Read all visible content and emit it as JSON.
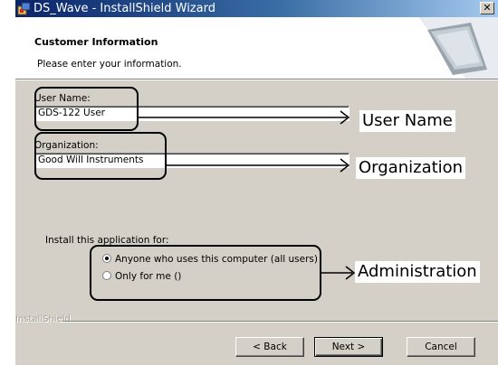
{
  "window": {
    "title": "DS_Wave - InstallShield Wizard"
  },
  "header": {
    "title": "Customer Information",
    "subtitle": "Please enter your information."
  },
  "form": {
    "user_name_label": "User Name:",
    "user_name_value": "GDS-122 User",
    "organization_label": "Organization:",
    "organization_value": "Good Will Instruments",
    "install_for_label": "Install this application for:",
    "radio_all_users": "Anyone who uses this computer (all users)",
    "radio_only_me": "Only for me ()"
  },
  "footer": {
    "brand": "InstallShield",
    "back_button": "< Back",
    "next_button": "Next >",
    "cancel_button": "Cancel"
  },
  "annotations": {
    "user_name": "User Name",
    "organization": "Organization",
    "administration": "Administration"
  }
}
